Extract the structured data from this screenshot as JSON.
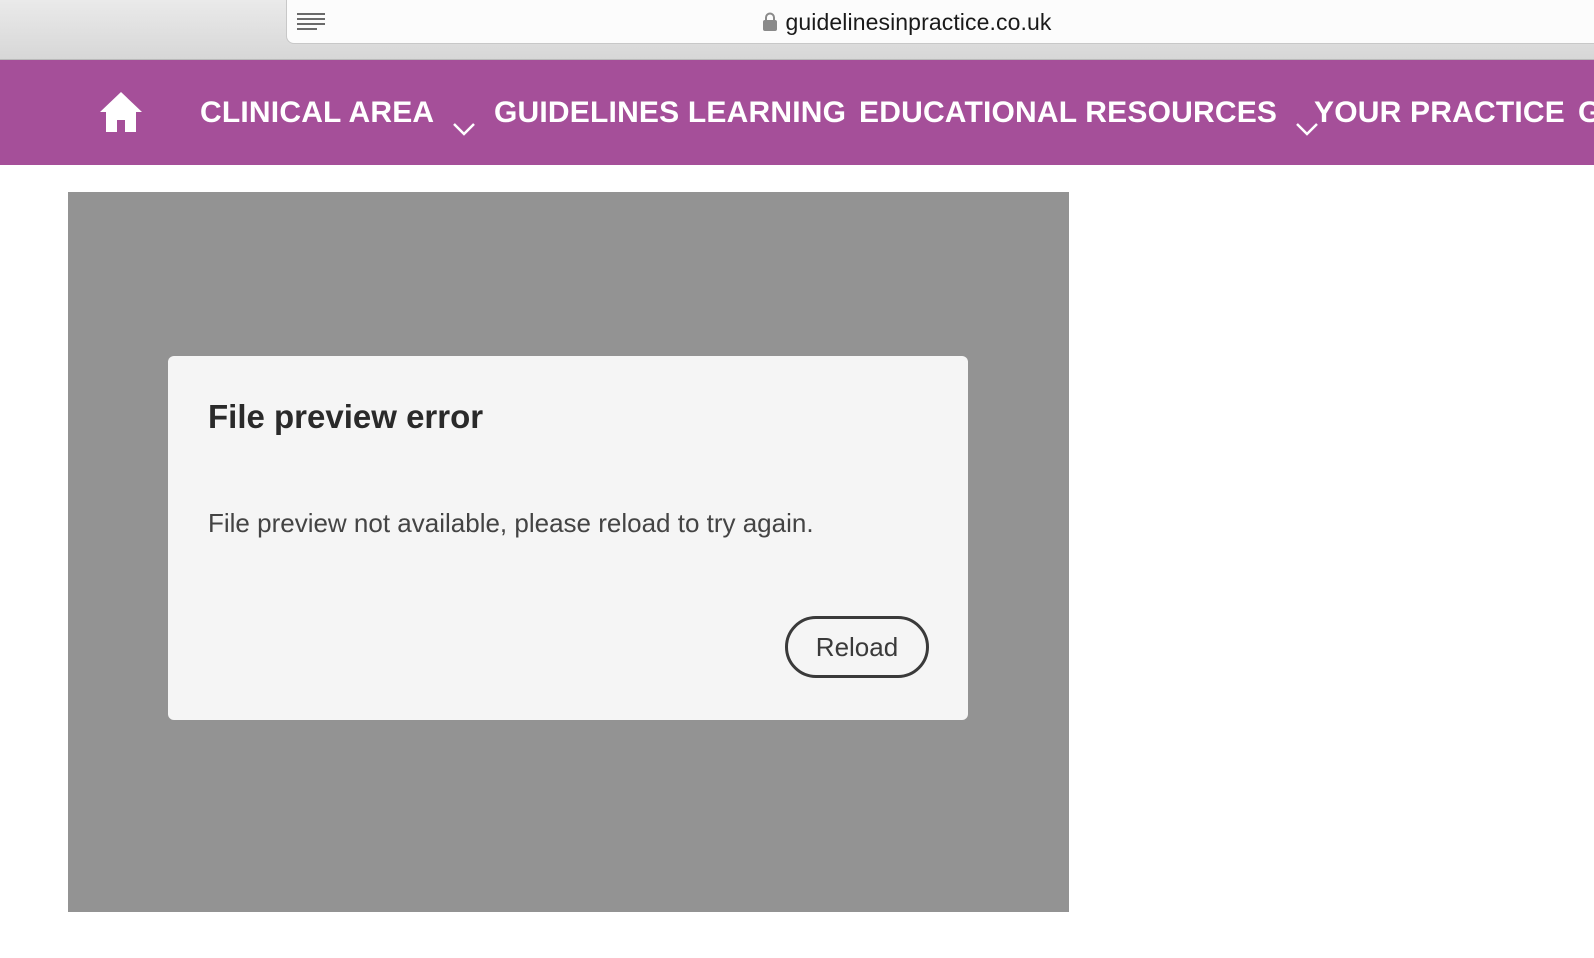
{
  "browser": {
    "url": "guidelinesinpractice.co.uk",
    "reader_icon": "reader-view-icon",
    "lock_icon": "lock-icon"
  },
  "nav": {
    "background_color": "#a54f99",
    "home_icon": "home-icon",
    "items": [
      {
        "label": "CLINICAL AREA",
        "has_dropdown": true
      },
      {
        "label": "GUIDELINES LEARNING",
        "has_dropdown": false
      },
      {
        "label": "EDUCATIONAL RESOURCES",
        "has_dropdown": true
      },
      {
        "label": "YOUR PRACTICE",
        "has_dropdown": false
      },
      {
        "label": "G",
        "has_dropdown": false
      }
    ]
  },
  "preview": {
    "background_color": "#939393",
    "dialog": {
      "title": "File preview error",
      "message": "File preview not available, please reload to try again.",
      "reload_label": "Reload"
    }
  }
}
